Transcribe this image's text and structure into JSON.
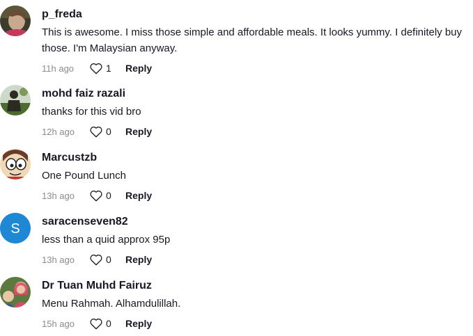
{
  "comments": [
    {
      "username": "p_freda",
      "text": "This is awesome. I miss those simple and affordable meals. It looks yummy. I definitely buy those. I'm Malaysian anyway.",
      "time": "11h ago",
      "likes": "1",
      "reply_label": "Reply",
      "avatar_colors": [
        "#c9a98d",
        "#6b4a3a",
        "#3d3a2e"
      ]
    },
    {
      "username": "mohd faiz razali",
      "text": "thanks for this vid bro",
      "time": "12h ago",
      "likes": "0",
      "reply_label": "Reply",
      "avatar_colors": [
        "#cfd9c9",
        "#4e6b2f",
        "#2b2b22"
      ]
    },
    {
      "username": "Marcustzb",
      "text": "One Pound Lunch",
      "time": "13h ago",
      "likes": "0",
      "reply_label": "Reply",
      "avatar_colors": [
        "#f1d9b7",
        "#6a3c2a",
        "#c23a2e"
      ]
    },
    {
      "username": "saracenseven82",
      "text": "less than a quid approx 95p",
      "time": "13h ago",
      "likes": "0",
      "reply_label": "Reply",
      "avatar_letter": "S",
      "avatar_colors": [
        "#1e88d4",
        "#ffffff",
        "#1e88d4"
      ]
    },
    {
      "username": "Dr Tuan Muhd Fairuz",
      "text": "Menu Rahmah. Alhamdulillah.",
      "time": "15h ago",
      "likes": "0",
      "reply_label": "Reply",
      "avatar_colors": [
        "#d84a6a",
        "#e8c4a8",
        "#5d7a3e"
      ]
    }
  ]
}
